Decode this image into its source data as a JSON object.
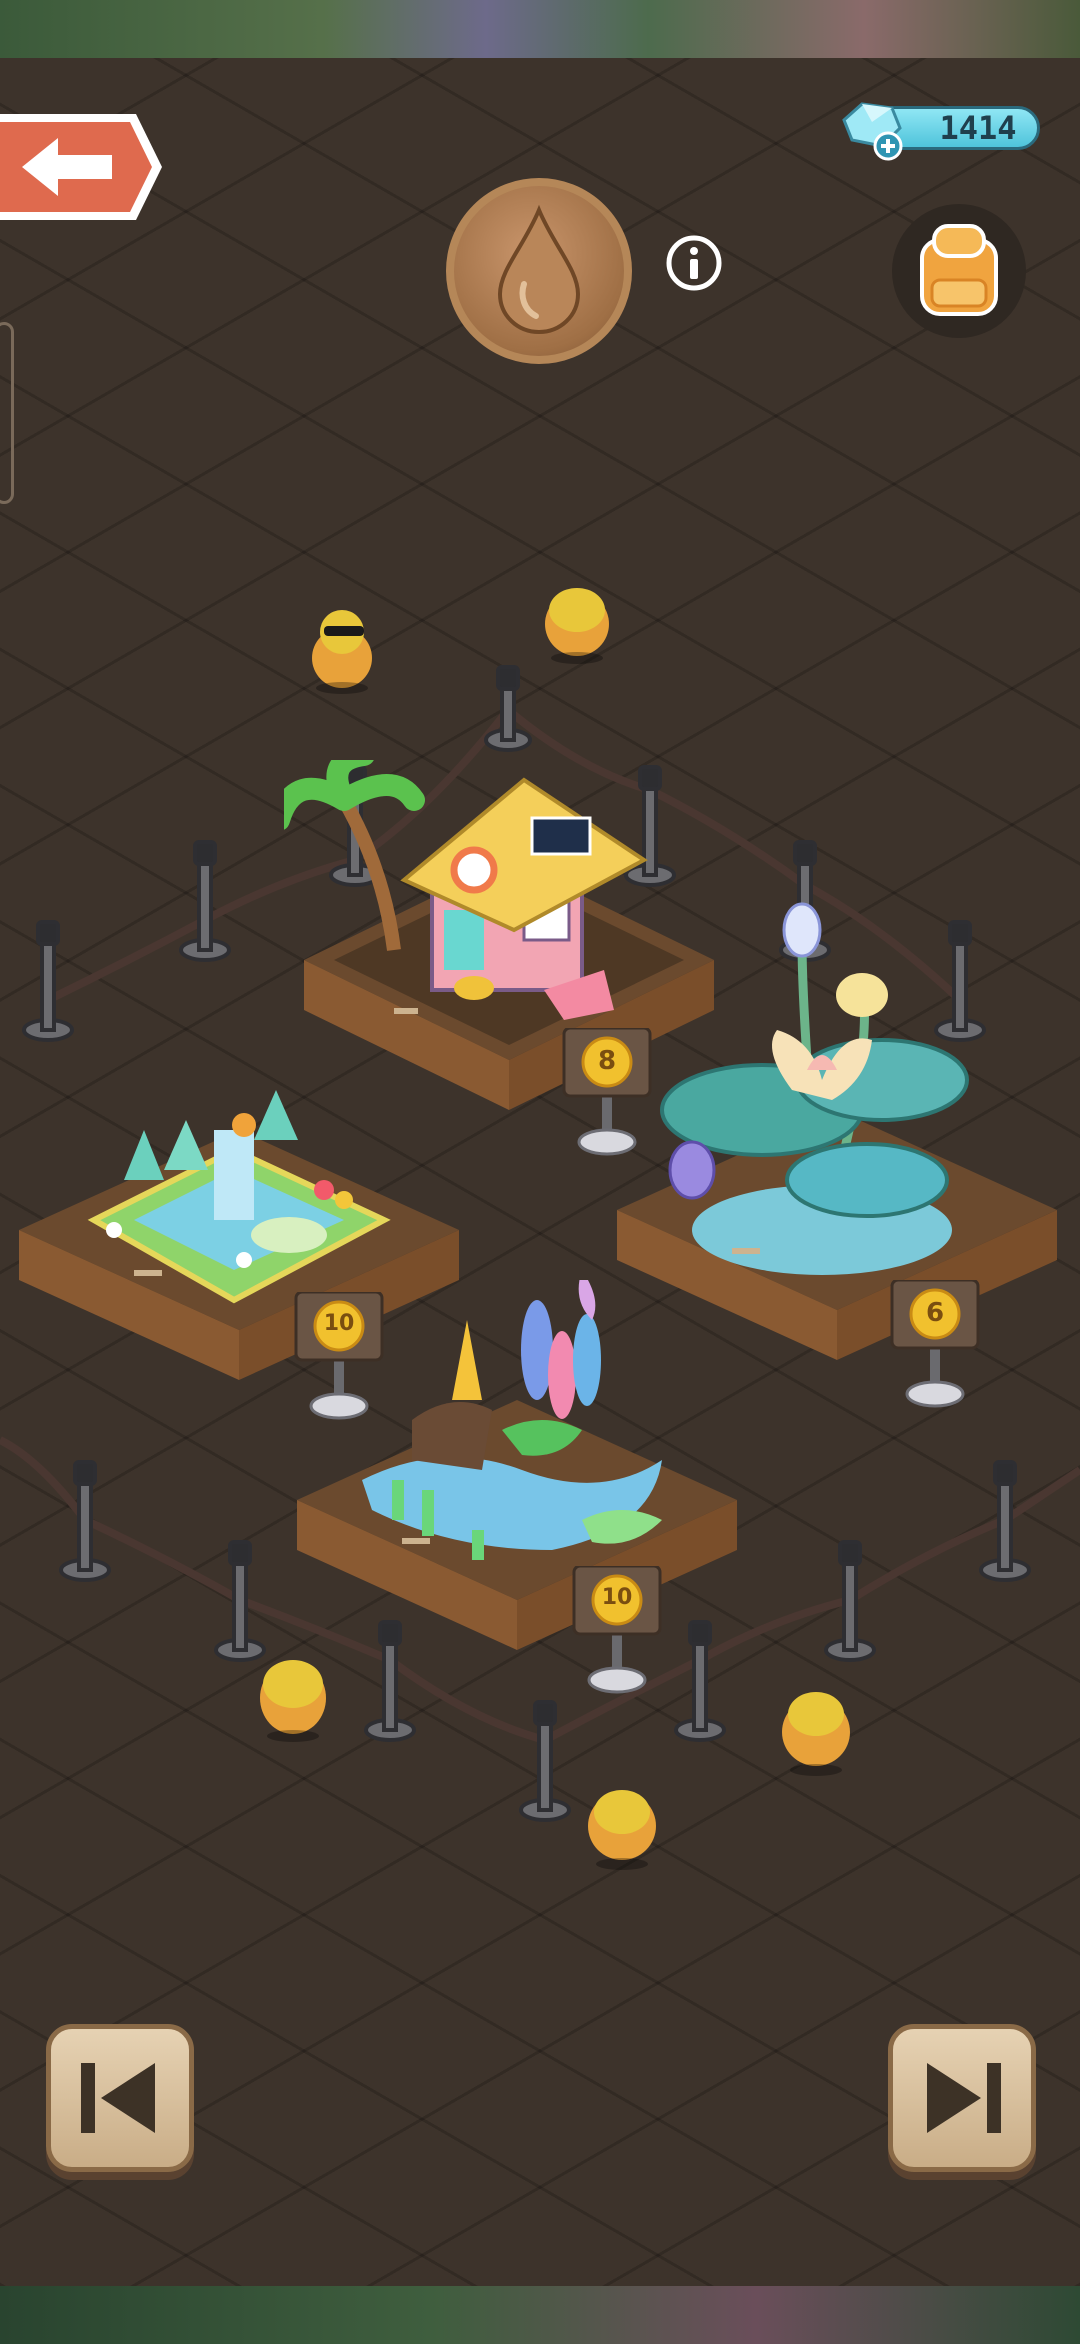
{
  "hud": {
    "gems": "1414",
    "back_icon": "left-arrow-icon",
    "gem_icon": "crystal-icon",
    "medal_icon": "water-drop-icon",
    "info_icon": "info-icon",
    "bag_icon": "backpack-icon"
  },
  "exhibits": [
    {
      "name": "beach-hut",
      "level": "8"
    },
    {
      "name": "fountain-garden",
      "level": "10"
    },
    {
      "name": "lotus-pond",
      "level": "6"
    },
    {
      "name": "flower-stream",
      "level": "10"
    }
  ],
  "nav": {
    "prev_icon": "skip-previous-icon",
    "next_icon": "skip-next-icon"
  },
  "colors": {
    "accent": "#e2664e",
    "gem": "#6fd3e6",
    "badge": "#f1c12e",
    "wood": "#8a5a32"
  }
}
